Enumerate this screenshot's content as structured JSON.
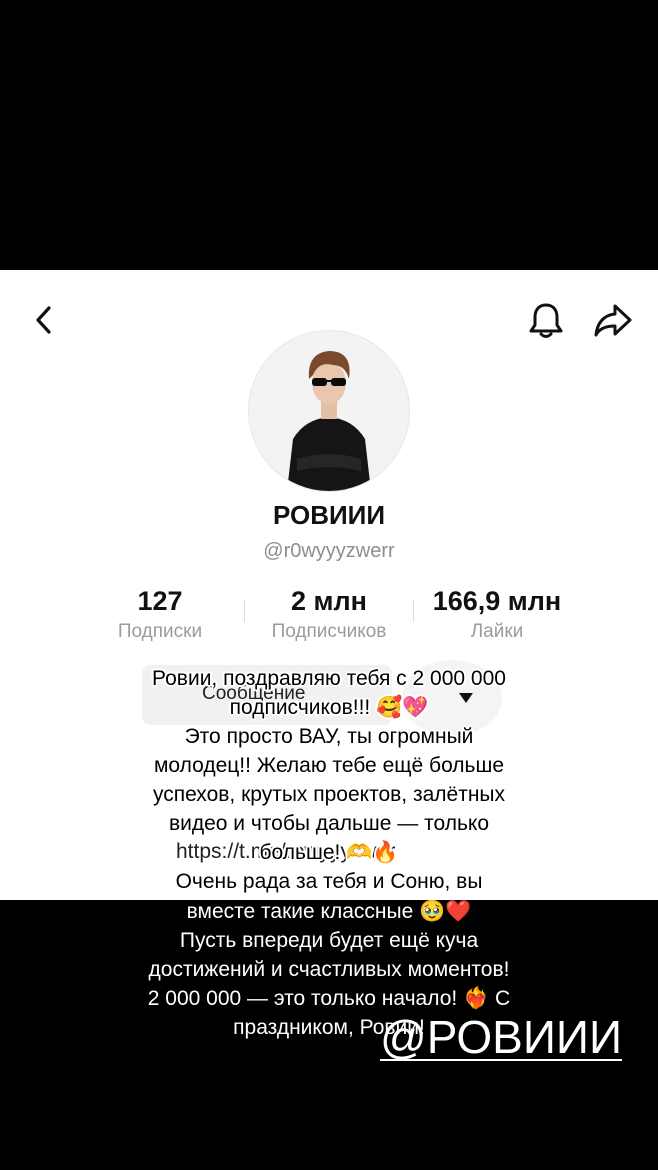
{
  "profile": {
    "display_name": "РОВИИИ",
    "handle": "@r0wyyyzwerr",
    "stats": [
      {
        "value": "127",
        "label": "Подписки"
      },
      {
        "value": "2 млн",
        "label": "Подписчиков"
      },
      {
        "value": "166,9 млн",
        "label": "Лайки"
      }
    ],
    "message_button_label": "Сообщение",
    "link_text": "https://t.me/rowyyyzwer"
  },
  "icons": {
    "back": "chevron-left-icon",
    "bell": "bell-icon",
    "share": "share-arrow-icon",
    "dropdown": "caret-down-icon"
  },
  "overlay": {
    "lines_on_white": [
      "Ровии, поздравляю тебя с 2 000 000",
      "подписчиков!!! 🥰💖",
      "Это просто ВАУ, ты огромный",
      "молодец!! Желаю тебе ещё больше",
      "успехов, крутых проектов, залётных",
      "видео и чтобы дальше — только",
      "больше! 🫶🔥",
      "Очень рада за тебя и Соню, вы"
    ],
    "lines_on_black": [
      "вместе такие классные 🥹❤️",
      "Пусть впереди будет ещё куча",
      "достижений и счастливых моментов!",
      "2 000 000 — это только начало! ❤️‍🔥 С",
      "праздником, Ровии!"
    ],
    "mention": "@РОВИИИ"
  },
  "colors": {
    "background": "#000000",
    "profile_bg": "#ffffff",
    "secondary_text": "#9b9b9b"
  }
}
